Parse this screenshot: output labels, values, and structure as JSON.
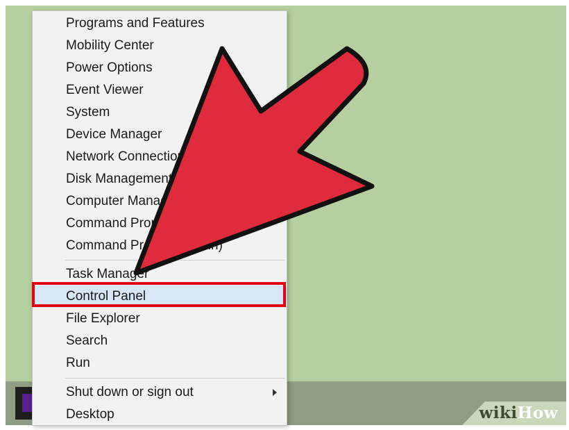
{
  "menu": {
    "items": [
      {
        "label": "Programs and Features"
      },
      {
        "label": "Mobility Center"
      },
      {
        "label": "Power Options"
      },
      {
        "label": "Event Viewer"
      },
      {
        "label": "System"
      },
      {
        "label": "Device Manager"
      },
      {
        "label": "Network Connections"
      },
      {
        "label": "Disk Management"
      },
      {
        "label": "Computer Management"
      },
      {
        "label": "Command Prompt"
      },
      {
        "label": "Command Prompt (Admin)"
      },
      {
        "label": "Task Manager"
      },
      {
        "label": "Control Panel"
      },
      {
        "label": "File Explorer"
      },
      {
        "label": "Search"
      },
      {
        "label": "Run"
      },
      {
        "label": "Shut down or sign out"
      },
      {
        "label": "Desktop"
      }
    ],
    "selected_label": "Control Panel"
  },
  "watermark": {
    "prefix": "wiki",
    "suffix": "How"
  },
  "colors": {
    "desktop": "#b6cfa0",
    "menu_background": "#f2f2f2",
    "highlight": "#e3000f",
    "arrow": "#e02b3c",
    "selected_row": "#d8e7f7"
  },
  "icons": [
    "chevron-right-icon",
    "windows-start-icon",
    "pointer-arrow-icon"
  ]
}
